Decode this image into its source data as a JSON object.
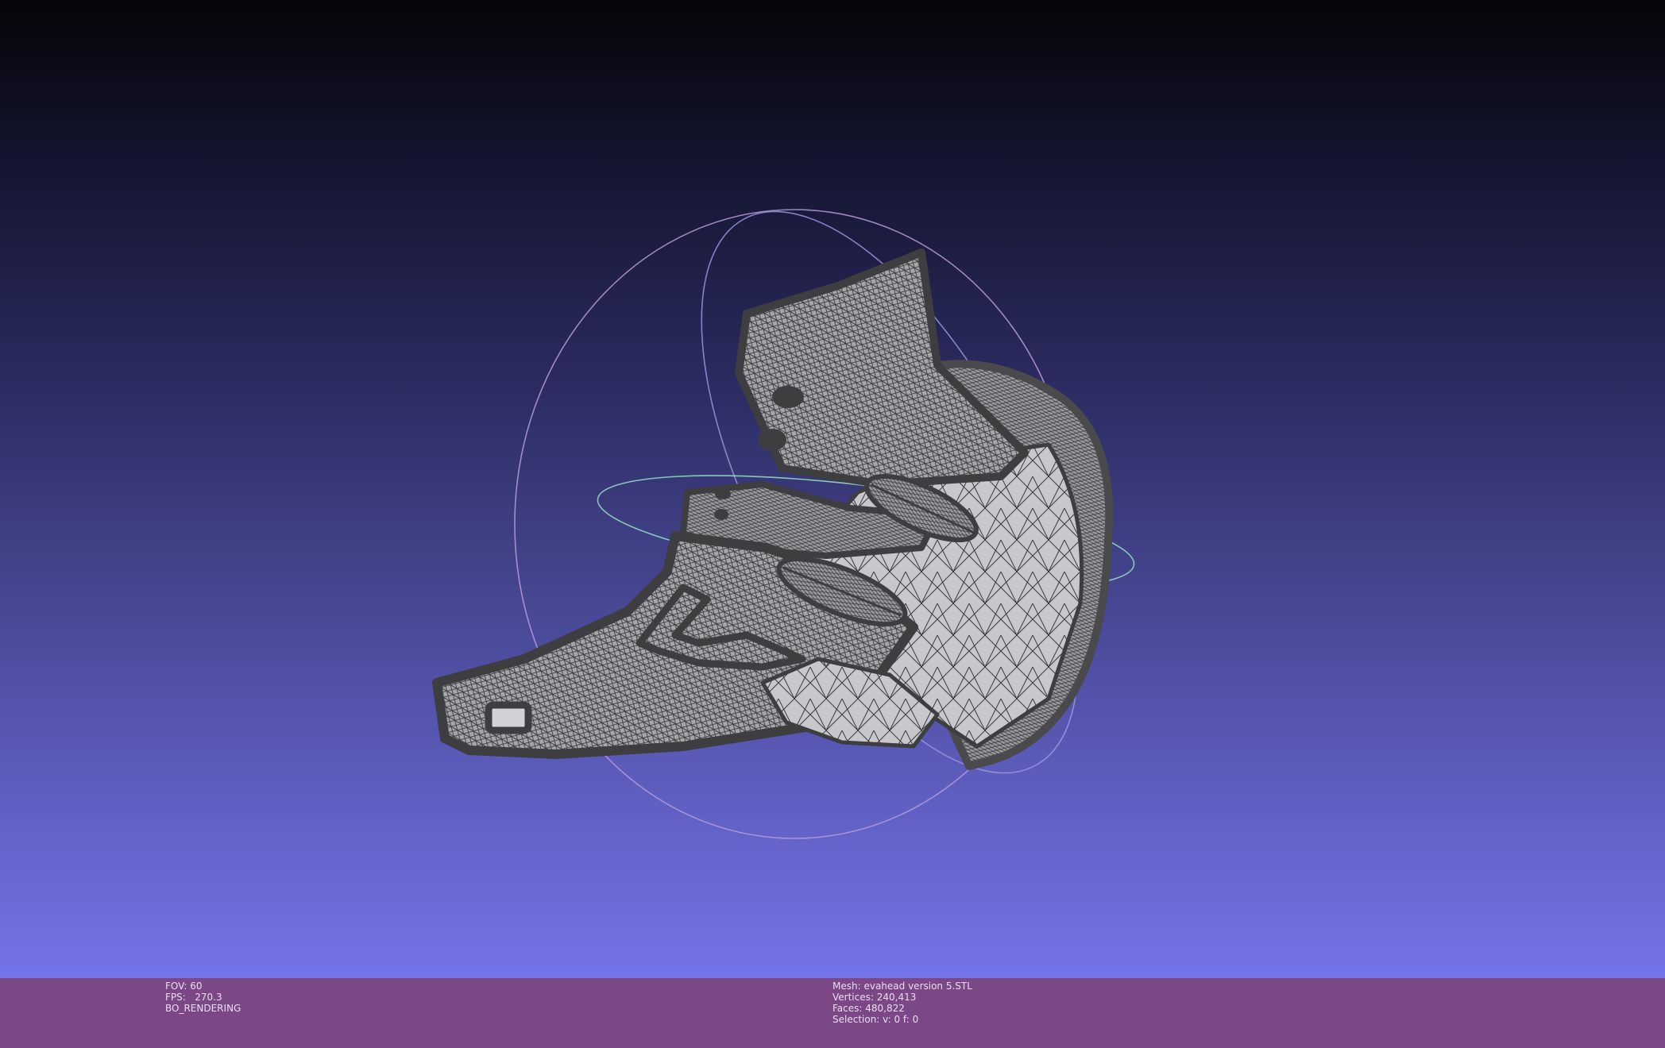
{
  "viewer": {
    "background_top": "#050509",
    "background_bottom": "#7474ea",
    "status_bar_color": "#7b4786",
    "mesh_color": "#a3a3a8",
    "wire_color": "#3a3a3c"
  },
  "render_info": {
    "fov_label": "FOV:",
    "fov_value": "60",
    "fps_label": "FPS:",
    "fps_value": "270.3",
    "render_mode": "BO_RENDERING"
  },
  "mesh_info": {
    "mesh_label": "Mesh:",
    "mesh_name": "evahead version 5.STL",
    "vertices_label": "Vertices:",
    "vertices_value": "240,413",
    "faces_label": "Faces:",
    "faces_value": "480,822",
    "selection_label": "Selection:",
    "selection_value": "v: 0 f: 0"
  }
}
